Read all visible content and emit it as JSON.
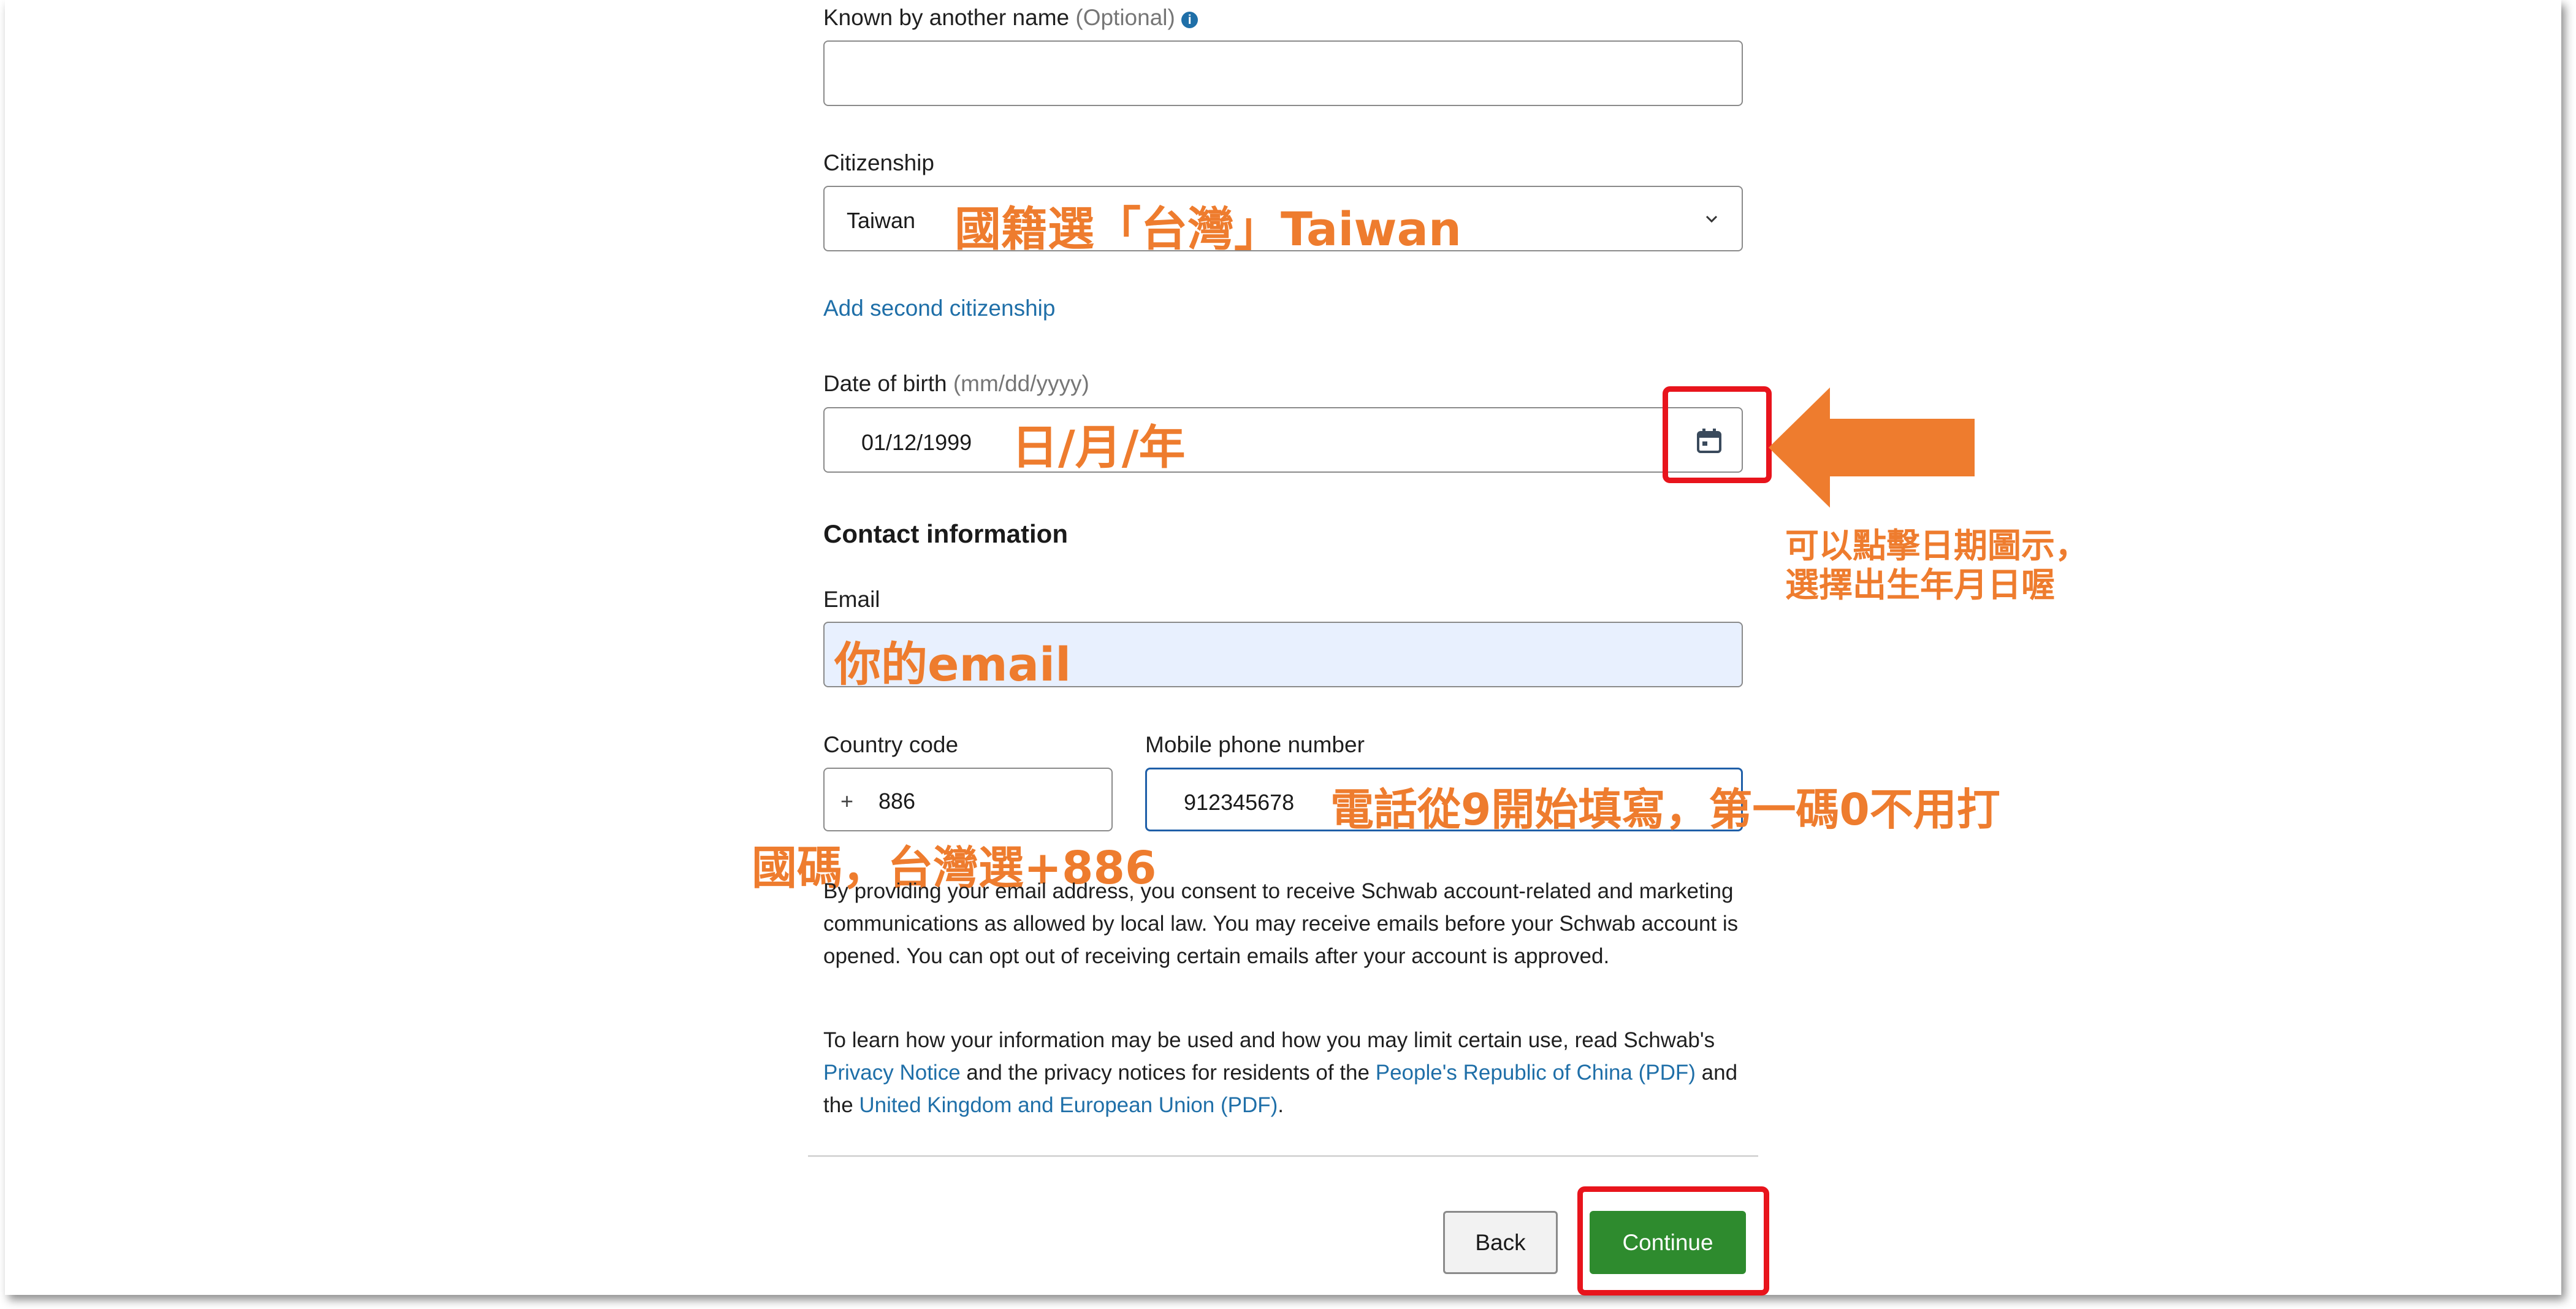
{
  "known_by": {
    "label": "Known by another name",
    "optional": "(Optional)",
    "value": ""
  },
  "citizenship": {
    "label": "Citizenship",
    "value": "Taiwan",
    "add_second": "Add second citizenship"
  },
  "dob": {
    "label": "Date of birth",
    "format_hint": "(mm/dd/yyyy)",
    "value": "01/12/1999"
  },
  "contact": {
    "heading": "Contact information",
    "email_label": "Email",
    "country_code_label": "Country code",
    "country_code_prefix": "+",
    "country_code_value": "886",
    "phone_label": "Mobile phone number",
    "phone_value": "912345678"
  },
  "consent": {
    "paragraph1": "By providing your email address, you consent to receive Schwab account-related and marketing communications as allowed by local law. You may receive emails before your Schwab account is opened. You can opt out of receiving certain emails after your account is approved.",
    "p2_part1": "To learn how your information may be used and how you may limit certain use, read Schwab's",
    "p2_link1": "Privacy Notice",
    "p2_part2": "and the privacy notices for residents of the",
    "p2_link2": "People's Republic of China (PDF)",
    "p2_part3": "and the",
    "p2_link3": "United Kingdom and European Union (PDF)",
    "p2_end": "."
  },
  "buttons": {
    "back": "Back",
    "continue": "Continue"
  },
  "annotations": {
    "citizenship_note": "國籍選「台灣」Taiwan",
    "dob_note": "日/月/年",
    "calendar_note_line1": "可以點擊日期圖示，",
    "calendar_note_line2": "選擇出生年月日喔",
    "email_note": "你的email",
    "phone_note": "電話從9開始填寫，第一碼0不用打",
    "country_note": "國碼，台灣選+886"
  },
  "colors": {
    "annotation": "#ee7c2e",
    "highlight_box": "#e8141c",
    "continue_button": "#2e8b2e",
    "link": "#1f6fa8",
    "email_field_bg": "#e8f0fe"
  }
}
